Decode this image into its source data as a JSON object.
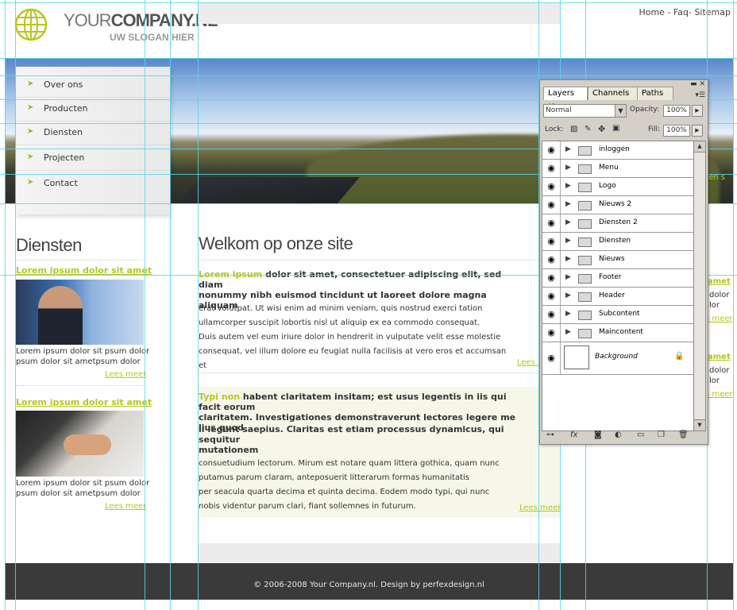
{
  "top_menu": {
    "home": "Home",
    "sep1": " - ",
    "faq": "Faq",
    "sep2": "- ",
    "sitemap": "Sitemap"
  },
  "logo": {
    "title_light": "YOUR",
    "title_bold": "COMPANY.NL",
    "slogan": "UW SLOGAN HIER",
    "icon": "globe-icon"
  },
  "nav": {
    "items": [
      "Over ons",
      "Producten",
      "Diensten",
      "Projecten",
      "Contact"
    ],
    "arrow": "➤"
  },
  "diensten": {
    "title": "Diensten",
    "items": [
      {
        "link": "Lorem ipsum dolor sit amet",
        "text1": "Lorem ipsum dolor sit psum dolor",
        "text2": "psum dolor sit ametpsum dolor",
        "more": "Lees meer"
      },
      {
        "link": "Lorem ipsum dolor sit amet",
        "text1": "Lorem ipsum dolor sit psum dolor",
        "text2": "psum dolor sit ametpsum dolor",
        "more": "Lees meer"
      }
    ]
  },
  "welkom": {
    "title": "Welkom op onze site",
    "lead_green": "Lorem ipsum",
    "lead_line1": " dolor sit amet, consectetuer adipiscing elit, sed diam",
    "lead_line2": "nonummy nibh euismod tincidunt ut laoreet dolore magna aliquam",
    "lines": [
      "erat volutpat. Ut wisi enim ad minim veniam, quis nostrud exerci tation",
      "ullamcorper suscipit lobortis nisl ut aliquip ex ea commodo consequat.",
      "Duis autem vel eum iriure dolor in hendrerit in vulputate velit esse molestie",
      "consequat, vel illum dolore eu feugiat nulla facilisis at vero eros et accumsan et"
    ],
    "more": "Lees m"
  },
  "typi": {
    "lead_green": "Typi non",
    "lead_line1": " habent claritatem insitam; est usus legentis in iis qui facit eorum",
    "lead_line2": "claritatem. Investigationes demonstraverunt lectores legere me lius quod",
    "lead2_line1": "ii legunt saepius. Claritas est etiam processus dynamicus, qui sequitur",
    "lead2_line2": "mutationem",
    "lines": [
      "consuetudium lectorum. Mirum est notare quam littera gothica, quam nunc",
      "putamus parum claram, anteposuerit litterarum formas humanitatis",
      "per seacula quarta decima et quinta decima. Eodem modo typi, qui nunc",
      "nobis videntur parum clari, fiant sollemnes in futurum."
    ],
    "more": "Lees meer"
  },
  "right_fragments": {
    "a1": "amet",
    "a2": "dolor",
    "a3": "lor",
    "a4": "s meer",
    "b1": "amet",
    "b2": "dolor",
    "b3": "lor",
    "b4": "s meer",
    "banner": "en s"
  },
  "footer": {
    "text": "© 2006-2008 Your Company.nl. Design by perfexdesign.nl"
  },
  "layers_panel": {
    "tabs": [
      "Layers",
      "Channels",
      "Paths"
    ],
    "tab_close": "×",
    "blend_mode": "Normal",
    "opacity_label": "Opacity:",
    "opacity_value": "100%",
    "lock_label": "Lock:",
    "fill_label": "Fill:",
    "fill_value": "100%",
    "layers": [
      "inloggen",
      "Menu",
      "Logo",
      "Nieuws 2",
      "Diensten 2",
      "Diensten",
      "Nieuws",
      "Footer",
      "Header",
      "Subcontent",
      "Maincontent"
    ],
    "background_layer": "Background",
    "bottom_icons": [
      "link-icon",
      "fx-icon",
      "mask-icon",
      "adjustment-icon",
      "group-icon",
      "new-layer-icon",
      "trash-icon"
    ]
  },
  "colors": {
    "accent_green": "#b6c61c",
    "footer_bg": "#3a3a3a",
    "guide_cyan": "#59d6e6",
    "panel_bg": "#d4d0c8"
  }
}
